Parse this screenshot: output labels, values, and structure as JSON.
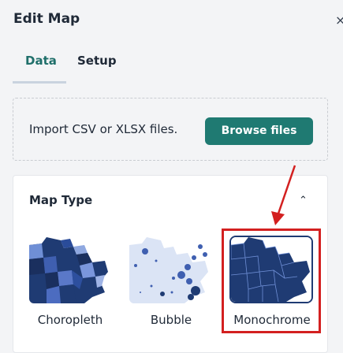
{
  "header": {
    "title": "Edit Map",
    "close_glyph": "×"
  },
  "tabs": [
    {
      "label": "Data",
      "active": true
    },
    {
      "label": "Setup",
      "active": false
    }
  ],
  "import": {
    "text": "Import CSV or XLSX files.",
    "button_label": "Browse files"
  },
  "map_type": {
    "label": "Map Type",
    "chevron_glyph": "⌃",
    "options": [
      {
        "label": "Choropleth",
        "icon": "choropleth-map-icon",
        "selected": false
      },
      {
        "label": "Bubble",
        "icon": "bubble-map-icon",
        "selected": false
      },
      {
        "label": "Monochrome",
        "icon": "monochrome-map-icon",
        "selected": true
      }
    ]
  },
  "colors": {
    "accent": "#1f7a72",
    "tab_active": "#1f6f6a",
    "map_dark": "#1f3b73",
    "map_light": "#8fa8e0",
    "annotation_red": "#d32020"
  }
}
